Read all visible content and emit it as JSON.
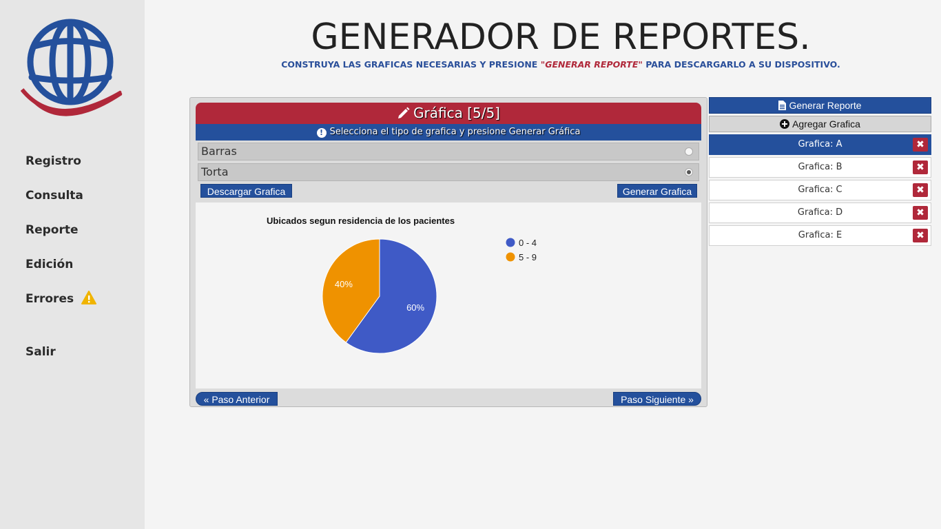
{
  "sidebar": {
    "items": [
      {
        "label": "Registro"
      },
      {
        "label": "Consulta"
      },
      {
        "label": "Reporte"
      },
      {
        "label": "Edición"
      },
      {
        "label": "Errores"
      },
      {
        "label": "Salir"
      }
    ]
  },
  "header": {
    "title": "GENERADOR DE REPORTES.",
    "subtitle_pre": "CONSTRUYA LAS GRAFICAS NECESARIAS Y PRESIONE ",
    "subtitle_em": "\"GENERAR REPORTE\"",
    "subtitle_post": " PARA DESCARGARLO A SU DISPOSITIVO."
  },
  "panel": {
    "title": "Gráfica [5/5]",
    "info": "Selecciona el tipo de grafica y presione Generar Gráfica",
    "options": [
      {
        "label": "Barras",
        "selected": false
      },
      {
        "label": "Torta",
        "selected": true
      }
    ],
    "download_label": "Descargar Grafica",
    "generate_label": "Generar Grafica",
    "prev_label": "Paso Anterior",
    "next_label": "Paso Siguiente"
  },
  "chart_data": {
    "type": "pie",
    "title": "Ubicados segun residencia de los pacientes",
    "categories": [
      "0 - 4",
      "5 - 9"
    ],
    "values": [
      60,
      40
    ],
    "labels": [
      "60%",
      "40%"
    ],
    "colors": [
      "#3f5ac6",
      "#ef9200"
    ],
    "legend": "right"
  },
  "right": {
    "generate_report_label": "Generar Reporte",
    "add_chart_label": "Agregar Grafica",
    "graficas": [
      {
        "label": "Grafica: A",
        "active": true
      },
      {
        "label": "Grafica: B",
        "active": false
      },
      {
        "label": "Grafica: C",
        "active": false
      },
      {
        "label": "Grafica: D",
        "active": false
      },
      {
        "label": "Grafica: E",
        "active": false
      }
    ],
    "delete_icon": "times-icon"
  },
  "colors": {
    "brand_red": "#b0283a",
    "brand_blue": "#24509c",
    "warning": "#f0b400"
  }
}
